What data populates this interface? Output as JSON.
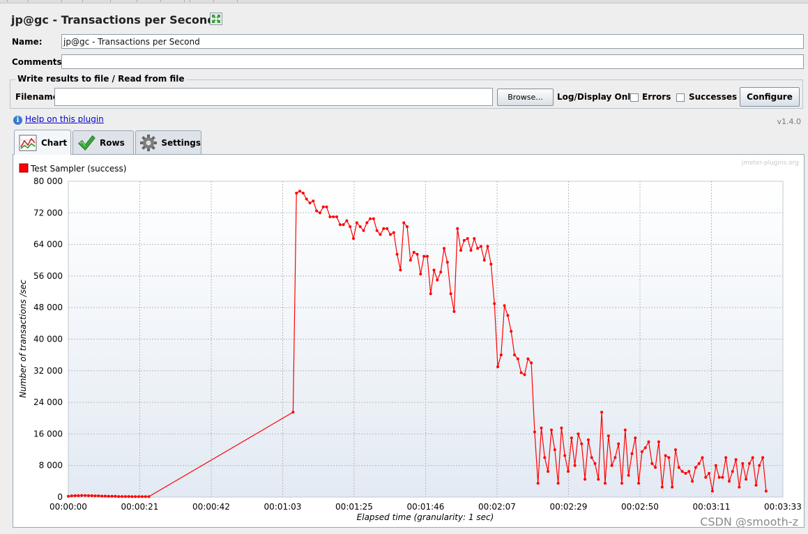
{
  "window": {
    "title": "jp@gc - Transactions per Second"
  },
  "form": {
    "name_label": "Name:",
    "name_value": "jp@gc - Transactions per Second",
    "comments_label": "Comments:",
    "comments_value": "",
    "file_group_title": "Write results to file / Read from file",
    "filename_label": "Filename",
    "filename_value": "",
    "browse_label": "Browse...",
    "log_display_label": "Log/Display Only:",
    "errors_label": "Errors",
    "successes_label": "Successes",
    "configure_label": "Configure"
  },
  "help": {
    "link_text": "Help on this plugin",
    "version": "v1.4.0"
  },
  "tabs": [
    {
      "label": "Chart",
      "icon": "chart-icon",
      "active": true
    },
    {
      "label": "Rows",
      "icon": "checkmark-icon",
      "active": false
    },
    {
      "label": "Settings",
      "icon": "gear-icon",
      "active": false
    }
  ],
  "watermarks": {
    "plugin": "jmeter-plugins.org",
    "csdn": "CSDN @smooth-z"
  },
  "chart_data": {
    "type": "line",
    "title": "",
    "xlabel": "Elapsed time (granularity: 1 sec)",
    "ylabel": "Number of transactions /sec",
    "ylim": [
      0,
      80000
    ],
    "yticks": [
      "0",
      "8 000",
      "16 000",
      "24 000",
      "32 000",
      "40 000",
      "48 000",
      "56 000",
      "64 000",
      "72 000",
      "80 000"
    ],
    "xlim_seconds": [
      0,
      213
    ],
    "xticks": [
      "00:00:00",
      "00:00:21",
      "00:00:42",
      "00:01:03",
      "00:01:25",
      "00:01:46",
      "00:02:07",
      "00:02:29",
      "00:02:50",
      "00:03:11",
      "00:03:33"
    ],
    "grid": true,
    "legend_position": "top-left",
    "series": [
      {
        "name": "Test Sampler (success)",
        "color": "#ff0000",
        "points": [
          [
            0,
            200
          ],
          [
            1,
            300
          ],
          [
            2,
            350
          ],
          [
            3,
            350
          ],
          [
            4,
            400
          ],
          [
            5,
            400
          ],
          [
            6,
            350
          ],
          [
            7,
            350
          ],
          [
            8,
            300
          ],
          [
            9,
            300
          ],
          [
            10,
            250
          ],
          [
            11,
            250
          ],
          [
            12,
            200
          ],
          [
            13,
            200
          ],
          [
            14,
            200
          ],
          [
            15,
            150
          ],
          [
            16,
            150
          ],
          [
            17,
            150
          ],
          [
            18,
            150
          ],
          [
            19,
            100
          ],
          [
            20,
            100
          ],
          [
            21,
            100
          ],
          [
            22,
            100
          ],
          [
            23,
            100
          ],
          [
            24,
            100
          ],
          [
            67,
            21500
          ],
          [
            68,
            77000
          ],
          [
            69,
            77500
          ],
          [
            70,
            77000
          ],
          [
            71,
            75500
          ],
          [
            72,
            74500
          ],
          [
            73,
            75000
          ],
          [
            74,
            72500
          ],
          [
            75,
            72000
          ],
          [
            76,
            73500
          ],
          [
            77,
            73500
          ],
          [
            78,
            71000
          ],
          [
            79,
            71000
          ],
          [
            80,
            71000
          ],
          [
            81,
            69000
          ],
          [
            82,
            69000
          ],
          [
            83,
            70000
          ],
          [
            84,
            68500
          ],
          [
            85,
            65500
          ],
          [
            86,
            69500
          ],
          [
            87,
            68500
          ],
          [
            88,
            67500
          ],
          [
            89,
            69500
          ],
          [
            90,
            70500
          ],
          [
            91,
            70500
          ],
          [
            92,
            67500
          ],
          [
            93,
            66500
          ],
          [
            94,
            68000
          ],
          [
            95,
            68000
          ],
          [
            96,
            66500
          ],
          [
            97,
            67000
          ],
          [
            98,
            61500
          ],
          [
            99,
            57500
          ],
          [
            100,
            69500
          ],
          [
            101,
            68500
          ],
          [
            102,
            60000
          ],
          [
            103,
            62000
          ],
          [
            104,
            61500
          ],
          [
            105,
            56500
          ],
          [
            106,
            61000
          ],
          [
            107,
            61000
          ],
          [
            108,
            51500
          ],
          [
            109,
            57500
          ],
          [
            110,
            55000
          ],
          [
            111,
            57000
          ],
          [
            112,
            63000
          ],
          [
            113,
            59500
          ],
          [
            114,
            51500
          ],
          [
            115,
            47000
          ],
          [
            116,
            68000
          ],
          [
            117,
            62500
          ],
          [
            118,
            65000
          ],
          [
            119,
            65500
          ],
          [
            120,
            62500
          ],
          [
            121,
            65500
          ],
          [
            122,
            63000
          ],
          [
            123,
            63500
          ],
          [
            124,
            60000
          ],
          [
            125,
            63500
          ],
          [
            126,
            59000
          ],
          [
            127,
            49000
          ],
          [
            128,
            33000
          ],
          [
            129,
            36000
          ],
          [
            130,
            48500
          ],
          [
            131,
            46000
          ],
          [
            132,
            42000
          ],
          [
            133,
            36000
          ],
          [
            134,
            35000
          ],
          [
            135,
            31500
          ],
          [
            136,
            31000
          ],
          [
            137,
            35000
          ],
          [
            138,
            34000
          ],
          [
            139,
            16500
          ],
          [
            140,
            3500
          ],
          [
            141,
            17500
          ],
          [
            142,
            10000
          ],
          [
            143,
            6500
          ],
          [
            144,
            17000
          ],
          [
            145,
            12000
          ],
          [
            146,
            3500
          ],
          [
            147,
            17500
          ],
          [
            148,
            10500
          ],
          [
            149,
            6500
          ],
          [
            150,
            15000
          ],
          [
            151,
            8000
          ],
          [
            152,
            16000
          ],
          [
            153,
            13500
          ],
          [
            154,
            4500
          ],
          [
            155,
            14500
          ],
          [
            156,
            10000
          ],
          [
            157,
            8500
          ],
          [
            158,
            4500
          ],
          [
            159,
            21500
          ],
          [
            160,
            3500
          ],
          [
            161,
            15500
          ],
          [
            162,
            8000
          ],
          [
            163,
            10000
          ],
          [
            164,
            13500
          ],
          [
            165,
            3500
          ],
          [
            166,
            17000
          ],
          [
            167,
            5500
          ],
          [
            168,
            11000
          ],
          [
            169,
            15000
          ],
          [
            170,
            3500
          ],
          [
            171,
            11500
          ],
          [
            172,
            12500
          ],
          [
            173,
            14000
          ],
          [
            174,
            8500
          ],
          [
            175,
            7500
          ],
          [
            176,
            14000
          ],
          [
            177,
            2500
          ],
          [
            178,
            10500
          ],
          [
            179,
            10000
          ],
          [
            180,
            2500
          ],
          [
            181,
            12000
          ],
          [
            182,
            7500
          ],
          [
            183,
            6500
          ],
          [
            184,
            6000
          ],
          [
            185,
            6500
          ],
          [
            186,
            4000
          ],
          [
            187,
            7500
          ],
          [
            188,
            8500
          ],
          [
            189,
            10000
          ],
          [
            190,
            5000
          ],
          [
            191,
            6000
          ],
          [
            192,
            1500
          ],
          [
            193,
            8000
          ],
          [
            194,
            5000
          ],
          [
            195,
            5000
          ],
          [
            196,
            10000
          ],
          [
            197,
            4000
          ],
          [
            198,
            6500
          ],
          [
            199,
            9500
          ],
          [
            200,
            2500
          ],
          [
            201,
            8500
          ],
          [
            202,
            4500
          ],
          [
            203,
            8500
          ],
          [
            204,
            10000
          ],
          [
            205,
            3000
          ],
          [
            206,
            8000
          ],
          [
            207,
            10000
          ],
          [
            208,
            1500
          ]
        ]
      }
    ]
  }
}
